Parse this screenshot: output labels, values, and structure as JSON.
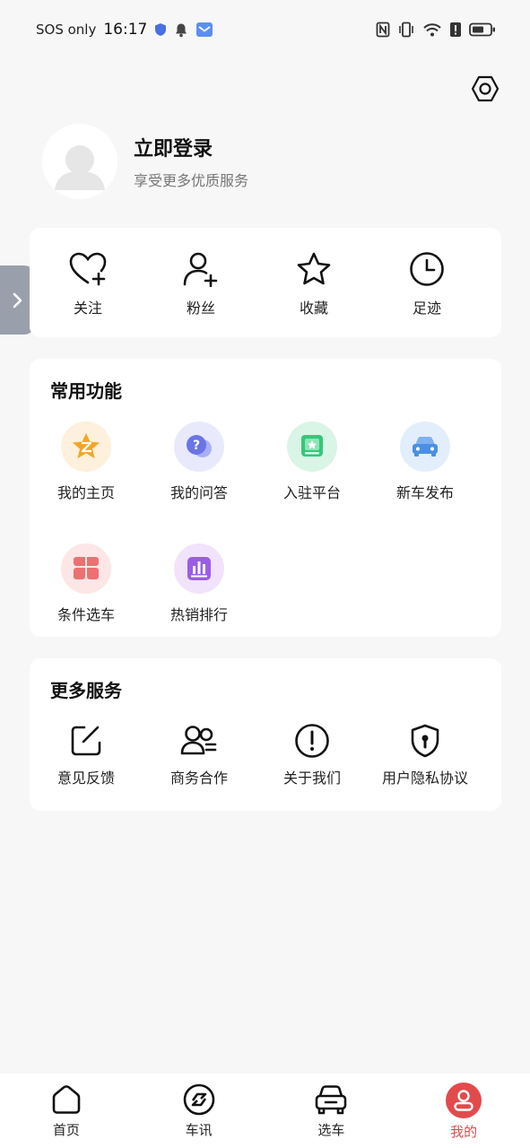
{
  "status_bar": {
    "carrier": "SOS only",
    "time": "16:17"
  },
  "profile": {
    "title": "立即登录",
    "subtitle": "享受更多优质服务"
  },
  "stats": [
    {
      "label": "关注",
      "icon": "heart-plus-icon"
    },
    {
      "label": "粉丝",
      "icon": "user-plus-icon"
    },
    {
      "label": "收藏",
      "icon": "star-icon"
    },
    {
      "label": "足迹",
      "icon": "clock-icon"
    }
  ],
  "functions": {
    "title": "常用功能",
    "items": [
      {
        "label": "我的主页",
        "icon": "star-badge-icon",
        "color": "#f5a623"
      },
      {
        "label": "我的问答",
        "icon": "question-chat-icon",
        "color": "#6a74e8"
      },
      {
        "label": "入驻平台",
        "icon": "shop-icon",
        "color": "#34c77b"
      },
      {
        "label": "新车发布",
        "icon": "car-icon",
        "color": "#4a90e2"
      },
      {
        "label": "条件选车",
        "icon": "clover-icon",
        "color": "#ef7070"
      },
      {
        "label": "热销排行",
        "icon": "bar-chart-icon",
        "color": "#9b5de5"
      }
    ]
  },
  "services": {
    "title": "更多服务",
    "items": [
      {
        "label": "意见反馈",
        "icon": "edit-icon"
      },
      {
        "label": "商务合作",
        "icon": "users-icon"
      },
      {
        "label": "关于我们",
        "icon": "alert-icon"
      },
      {
        "label": "用户隐私协议",
        "icon": "shield-lock-icon"
      }
    ]
  },
  "nav": [
    {
      "label": "首页",
      "icon": "home-icon"
    },
    {
      "label": "车讯",
      "icon": "news-icon"
    },
    {
      "label": "选车",
      "icon": "car-select-icon"
    },
    {
      "label": "我的",
      "icon": "profile-icon",
      "active": true
    }
  ],
  "colors": {
    "accent": "#e14b4b",
    "background": "#f7f7f7",
    "card": "#ffffff"
  }
}
